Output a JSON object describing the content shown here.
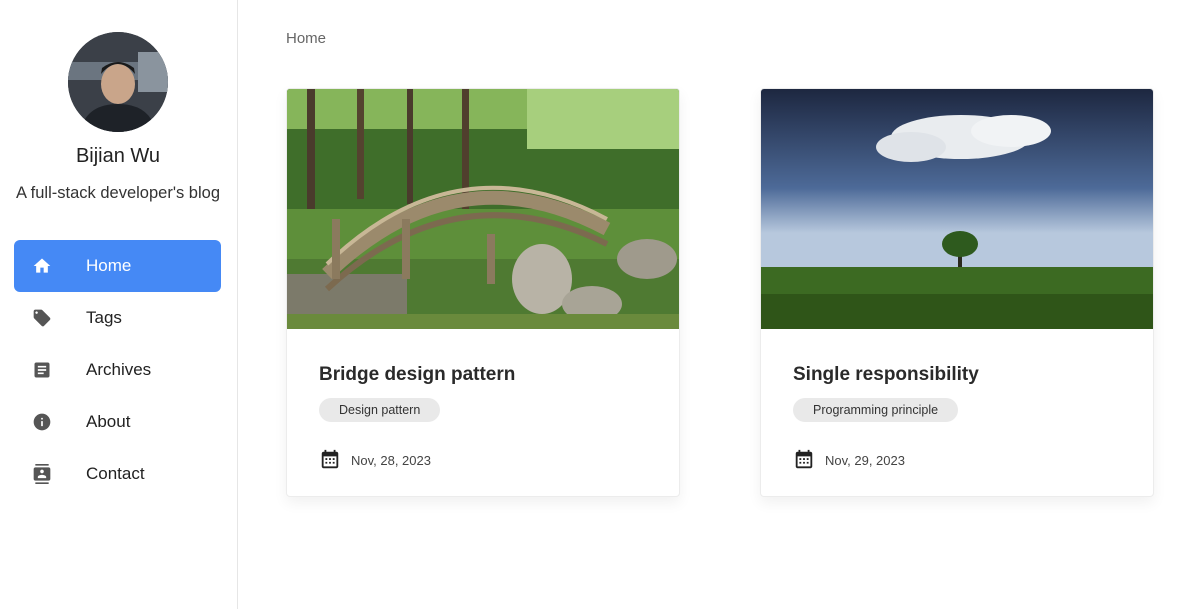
{
  "sidebar": {
    "author_name": "Bijian Wu",
    "author_bio": "A full-stack developer's blog",
    "nav": [
      {
        "label": "Home",
        "icon": "home-icon",
        "active": true
      },
      {
        "label": "Tags",
        "icon": "tag-icon"
      },
      {
        "label": "Archives",
        "icon": "archive-icon"
      },
      {
        "label": "About",
        "icon": "info-icon"
      },
      {
        "label": "Contact",
        "icon": "contact-icon"
      }
    ]
  },
  "main": {
    "breadcrumb": "Home",
    "posts": [
      {
        "title": "Bridge design pattern",
        "tag": "Design pattern",
        "date": "Nov, 28, 2023",
        "image": "garden-bridge-photo"
      },
      {
        "title": "Single responsibility",
        "tag": "Programming principle",
        "date": "Nov, 29, 2023",
        "image": "lone-tree-field-photo"
      }
    ]
  },
  "colors": {
    "accent": "#4589f5",
    "tag_bg": "#e9e9e9"
  }
}
